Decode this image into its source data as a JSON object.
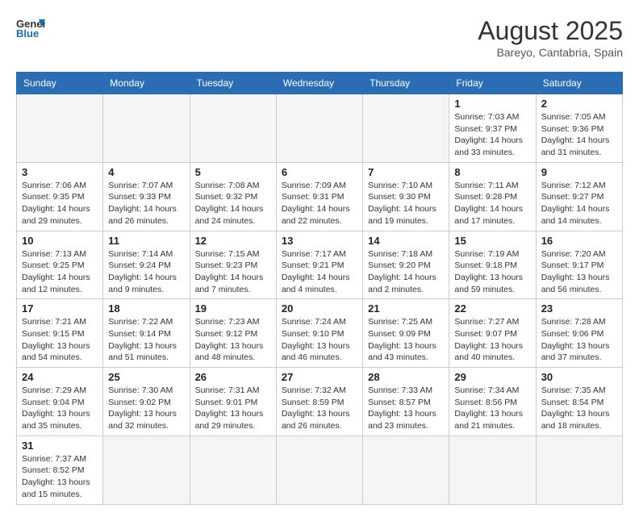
{
  "header": {
    "logo_general": "General",
    "logo_blue": "Blue",
    "month_year": "August 2025",
    "location": "Bareyo, Cantabria, Spain"
  },
  "weekdays": [
    "Sunday",
    "Monday",
    "Tuesday",
    "Wednesday",
    "Thursday",
    "Friday",
    "Saturday"
  ],
  "weeks": [
    [
      {
        "day": "",
        "info": "",
        "empty": true
      },
      {
        "day": "",
        "info": "",
        "empty": true
      },
      {
        "day": "",
        "info": "",
        "empty": true
      },
      {
        "day": "",
        "info": "",
        "empty": true
      },
      {
        "day": "",
        "info": "",
        "empty": true
      },
      {
        "day": "1",
        "info": "Sunrise: 7:03 AM\nSunset: 9:37 PM\nDaylight: 14 hours and 33 minutes.",
        "empty": false
      },
      {
        "day": "2",
        "info": "Sunrise: 7:05 AM\nSunset: 9:36 PM\nDaylight: 14 hours and 31 minutes.",
        "empty": false
      }
    ],
    [
      {
        "day": "3",
        "info": "Sunrise: 7:06 AM\nSunset: 9:35 PM\nDaylight: 14 hours and 29 minutes.",
        "empty": false
      },
      {
        "day": "4",
        "info": "Sunrise: 7:07 AM\nSunset: 9:33 PM\nDaylight: 14 hours and 26 minutes.",
        "empty": false
      },
      {
        "day": "5",
        "info": "Sunrise: 7:08 AM\nSunset: 9:32 PM\nDaylight: 14 hours and 24 minutes.",
        "empty": false
      },
      {
        "day": "6",
        "info": "Sunrise: 7:09 AM\nSunset: 9:31 PM\nDaylight: 14 hours and 22 minutes.",
        "empty": false
      },
      {
        "day": "7",
        "info": "Sunrise: 7:10 AM\nSunset: 9:30 PM\nDaylight: 14 hours and 19 minutes.",
        "empty": false
      },
      {
        "day": "8",
        "info": "Sunrise: 7:11 AM\nSunset: 9:28 PM\nDaylight: 14 hours and 17 minutes.",
        "empty": false
      },
      {
        "day": "9",
        "info": "Sunrise: 7:12 AM\nSunset: 9:27 PM\nDaylight: 14 hours and 14 minutes.",
        "empty": false
      }
    ],
    [
      {
        "day": "10",
        "info": "Sunrise: 7:13 AM\nSunset: 9:25 PM\nDaylight: 14 hours and 12 minutes.",
        "empty": false
      },
      {
        "day": "11",
        "info": "Sunrise: 7:14 AM\nSunset: 9:24 PM\nDaylight: 14 hours and 9 minutes.",
        "empty": false
      },
      {
        "day": "12",
        "info": "Sunrise: 7:15 AM\nSunset: 9:23 PM\nDaylight: 14 hours and 7 minutes.",
        "empty": false
      },
      {
        "day": "13",
        "info": "Sunrise: 7:17 AM\nSunset: 9:21 PM\nDaylight: 14 hours and 4 minutes.",
        "empty": false
      },
      {
        "day": "14",
        "info": "Sunrise: 7:18 AM\nSunset: 9:20 PM\nDaylight: 14 hours and 2 minutes.",
        "empty": false
      },
      {
        "day": "15",
        "info": "Sunrise: 7:19 AM\nSunset: 9:18 PM\nDaylight: 13 hours and 59 minutes.",
        "empty": false
      },
      {
        "day": "16",
        "info": "Sunrise: 7:20 AM\nSunset: 9:17 PM\nDaylight: 13 hours and 56 minutes.",
        "empty": false
      }
    ],
    [
      {
        "day": "17",
        "info": "Sunrise: 7:21 AM\nSunset: 9:15 PM\nDaylight: 13 hours and 54 minutes.",
        "empty": false
      },
      {
        "day": "18",
        "info": "Sunrise: 7:22 AM\nSunset: 9:14 PM\nDaylight: 13 hours and 51 minutes.",
        "empty": false
      },
      {
        "day": "19",
        "info": "Sunrise: 7:23 AM\nSunset: 9:12 PM\nDaylight: 13 hours and 48 minutes.",
        "empty": false
      },
      {
        "day": "20",
        "info": "Sunrise: 7:24 AM\nSunset: 9:10 PM\nDaylight: 13 hours and 46 minutes.",
        "empty": false
      },
      {
        "day": "21",
        "info": "Sunrise: 7:25 AM\nSunset: 9:09 PM\nDaylight: 13 hours and 43 minutes.",
        "empty": false
      },
      {
        "day": "22",
        "info": "Sunrise: 7:27 AM\nSunset: 9:07 PM\nDaylight: 13 hours and 40 minutes.",
        "empty": false
      },
      {
        "day": "23",
        "info": "Sunrise: 7:28 AM\nSunset: 9:06 PM\nDaylight: 13 hours and 37 minutes.",
        "empty": false
      }
    ],
    [
      {
        "day": "24",
        "info": "Sunrise: 7:29 AM\nSunset: 9:04 PM\nDaylight: 13 hours and 35 minutes.",
        "empty": false
      },
      {
        "day": "25",
        "info": "Sunrise: 7:30 AM\nSunset: 9:02 PM\nDaylight: 13 hours and 32 minutes.",
        "empty": false
      },
      {
        "day": "26",
        "info": "Sunrise: 7:31 AM\nSunset: 9:01 PM\nDaylight: 13 hours and 29 minutes.",
        "empty": false
      },
      {
        "day": "27",
        "info": "Sunrise: 7:32 AM\nSunset: 8:59 PM\nDaylight: 13 hours and 26 minutes.",
        "empty": false
      },
      {
        "day": "28",
        "info": "Sunrise: 7:33 AM\nSunset: 8:57 PM\nDaylight: 13 hours and 23 minutes.",
        "empty": false
      },
      {
        "day": "29",
        "info": "Sunrise: 7:34 AM\nSunset: 8:56 PM\nDaylight: 13 hours and 21 minutes.",
        "empty": false
      },
      {
        "day": "30",
        "info": "Sunrise: 7:35 AM\nSunset: 8:54 PM\nDaylight: 13 hours and 18 minutes.",
        "empty": false
      }
    ],
    [
      {
        "day": "31",
        "info": "Sunrise: 7:37 AM\nSunset: 8:52 PM\nDaylight: 13 hours and 15 minutes.",
        "empty": false
      },
      {
        "day": "",
        "info": "",
        "empty": true
      },
      {
        "day": "",
        "info": "",
        "empty": true
      },
      {
        "day": "",
        "info": "",
        "empty": true
      },
      {
        "day": "",
        "info": "",
        "empty": true
      },
      {
        "day": "",
        "info": "",
        "empty": true
      },
      {
        "day": "",
        "info": "",
        "empty": true
      }
    ]
  ]
}
